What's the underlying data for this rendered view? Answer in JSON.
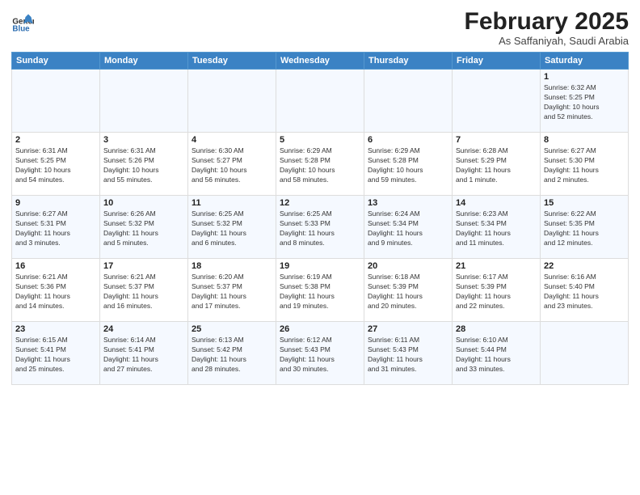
{
  "logo": {
    "text_general": "General",
    "text_blue": "Blue"
  },
  "title": "February 2025",
  "subtitle": "As Saffaniyah, Saudi Arabia",
  "days_of_week": [
    "Sunday",
    "Monday",
    "Tuesday",
    "Wednesday",
    "Thursday",
    "Friday",
    "Saturday"
  ],
  "weeks": [
    [
      {
        "day": "",
        "info": ""
      },
      {
        "day": "",
        "info": ""
      },
      {
        "day": "",
        "info": ""
      },
      {
        "day": "",
        "info": ""
      },
      {
        "day": "",
        "info": ""
      },
      {
        "day": "",
        "info": ""
      },
      {
        "day": "1",
        "info": "Sunrise: 6:32 AM\nSunset: 5:25 PM\nDaylight: 10 hours\nand 52 minutes."
      }
    ],
    [
      {
        "day": "2",
        "info": "Sunrise: 6:31 AM\nSunset: 5:25 PM\nDaylight: 10 hours\nand 54 minutes."
      },
      {
        "day": "3",
        "info": "Sunrise: 6:31 AM\nSunset: 5:26 PM\nDaylight: 10 hours\nand 55 minutes."
      },
      {
        "day": "4",
        "info": "Sunrise: 6:30 AM\nSunset: 5:27 PM\nDaylight: 10 hours\nand 56 minutes."
      },
      {
        "day": "5",
        "info": "Sunrise: 6:29 AM\nSunset: 5:28 PM\nDaylight: 10 hours\nand 58 minutes."
      },
      {
        "day": "6",
        "info": "Sunrise: 6:29 AM\nSunset: 5:28 PM\nDaylight: 10 hours\nand 59 minutes."
      },
      {
        "day": "7",
        "info": "Sunrise: 6:28 AM\nSunset: 5:29 PM\nDaylight: 11 hours\nand 1 minute."
      },
      {
        "day": "8",
        "info": "Sunrise: 6:27 AM\nSunset: 5:30 PM\nDaylight: 11 hours\nand 2 minutes."
      }
    ],
    [
      {
        "day": "9",
        "info": "Sunrise: 6:27 AM\nSunset: 5:31 PM\nDaylight: 11 hours\nand 3 minutes."
      },
      {
        "day": "10",
        "info": "Sunrise: 6:26 AM\nSunset: 5:32 PM\nDaylight: 11 hours\nand 5 minutes."
      },
      {
        "day": "11",
        "info": "Sunrise: 6:25 AM\nSunset: 5:32 PM\nDaylight: 11 hours\nand 6 minutes."
      },
      {
        "day": "12",
        "info": "Sunrise: 6:25 AM\nSunset: 5:33 PM\nDaylight: 11 hours\nand 8 minutes."
      },
      {
        "day": "13",
        "info": "Sunrise: 6:24 AM\nSunset: 5:34 PM\nDaylight: 11 hours\nand 9 minutes."
      },
      {
        "day": "14",
        "info": "Sunrise: 6:23 AM\nSunset: 5:34 PM\nDaylight: 11 hours\nand 11 minutes."
      },
      {
        "day": "15",
        "info": "Sunrise: 6:22 AM\nSunset: 5:35 PM\nDaylight: 11 hours\nand 12 minutes."
      }
    ],
    [
      {
        "day": "16",
        "info": "Sunrise: 6:21 AM\nSunset: 5:36 PM\nDaylight: 11 hours\nand 14 minutes."
      },
      {
        "day": "17",
        "info": "Sunrise: 6:21 AM\nSunset: 5:37 PM\nDaylight: 11 hours\nand 16 minutes."
      },
      {
        "day": "18",
        "info": "Sunrise: 6:20 AM\nSunset: 5:37 PM\nDaylight: 11 hours\nand 17 minutes."
      },
      {
        "day": "19",
        "info": "Sunrise: 6:19 AM\nSunset: 5:38 PM\nDaylight: 11 hours\nand 19 minutes."
      },
      {
        "day": "20",
        "info": "Sunrise: 6:18 AM\nSunset: 5:39 PM\nDaylight: 11 hours\nand 20 minutes."
      },
      {
        "day": "21",
        "info": "Sunrise: 6:17 AM\nSunset: 5:39 PM\nDaylight: 11 hours\nand 22 minutes."
      },
      {
        "day": "22",
        "info": "Sunrise: 6:16 AM\nSunset: 5:40 PM\nDaylight: 11 hours\nand 23 minutes."
      }
    ],
    [
      {
        "day": "23",
        "info": "Sunrise: 6:15 AM\nSunset: 5:41 PM\nDaylight: 11 hours\nand 25 minutes."
      },
      {
        "day": "24",
        "info": "Sunrise: 6:14 AM\nSunset: 5:41 PM\nDaylight: 11 hours\nand 27 minutes."
      },
      {
        "day": "25",
        "info": "Sunrise: 6:13 AM\nSunset: 5:42 PM\nDaylight: 11 hours\nand 28 minutes."
      },
      {
        "day": "26",
        "info": "Sunrise: 6:12 AM\nSunset: 5:43 PM\nDaylight: 11 hours\nand 30 minutes."
      },
      {
        "day": "27",
        "info": "Sunrise: 6:11 AM\nSunset: 5:43 PM\nDaylight: 11 hours\nand 31 minutes."
      },
      {
        "day": "28",
        "info": "Sunrise: 6:10 AM\nSunset: 5:44 PM\nDaylight: 11 hours\nand 33 minutes."
      },
      {
        "day": "",
        "info": ""
      }
    ]
  ]
}
